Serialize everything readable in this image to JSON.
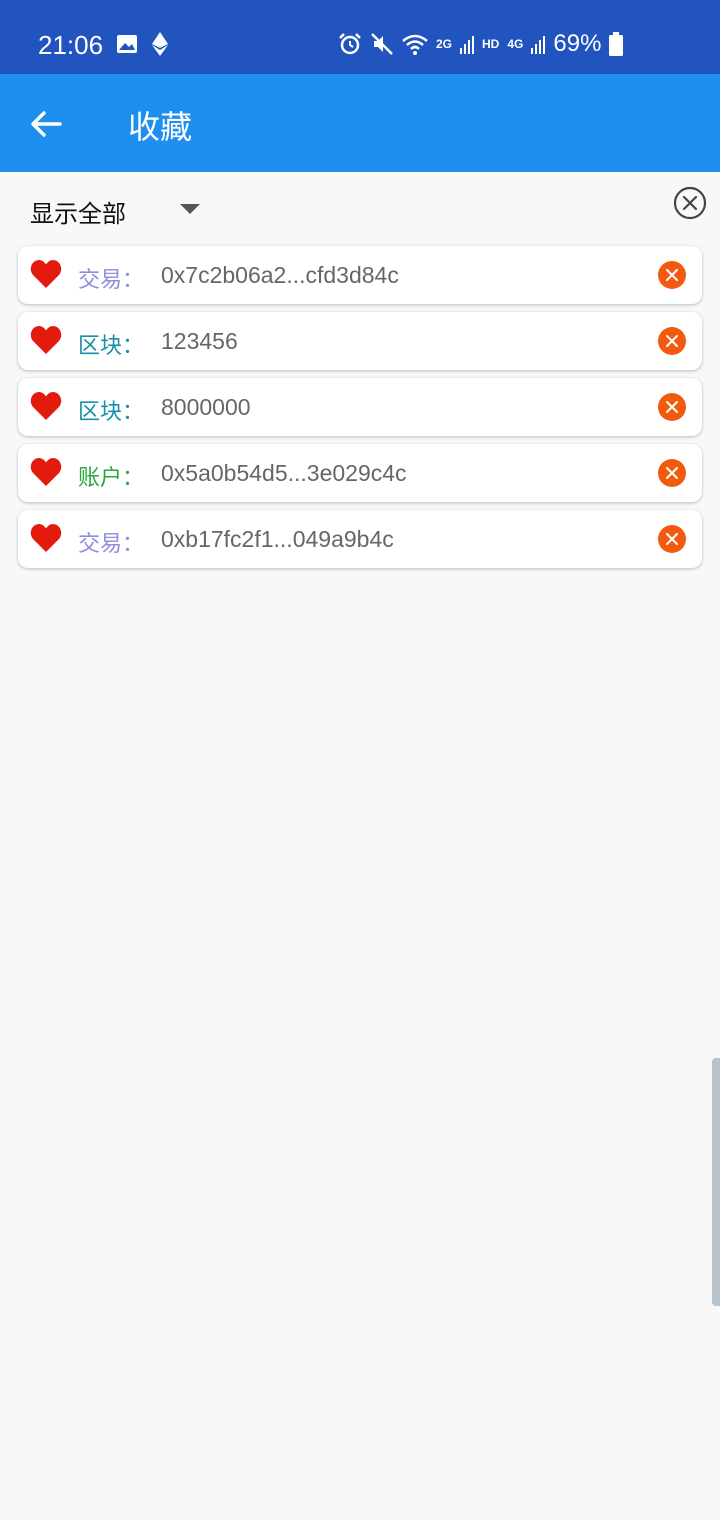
{
  "status_bar": {
    "time": "21:06",
    "network_2g": "2G",
    "network_hd": "HD",
    "network_4g": "4G",
    "battery": "69%"
  },
  "app_bar": {
    "title": "收藏"
  },
  "filter": {
    "label": "显示全部"
  },
  "colors": {
    "status_bar": "#2254c0",
    "app_bar": "#1f8fef",
    "heart": "#e31b0f",
    "remove": "#f25a0f",
    "tx": "#8e8ede",
    "block": "#1a8fa8",
    "account": "#2aa63a"
  },
  "items": [
    {
      "type": "交易：",
      "value": "0x7c2b06a2...cfd3d84c"
    },
    {
      "type": "区块：",
      "value": "123456"
    },
    {
      "type": "区块：",
      "value": "8000000"
    },
    {
      "type": "账户：",
      "value": "0x5a0b54d5...3e029c4c"
    },
    {
      "type": "交易：",
      "value": "0xb17fc2f1...049a9b4c"
    }
  ]
}
